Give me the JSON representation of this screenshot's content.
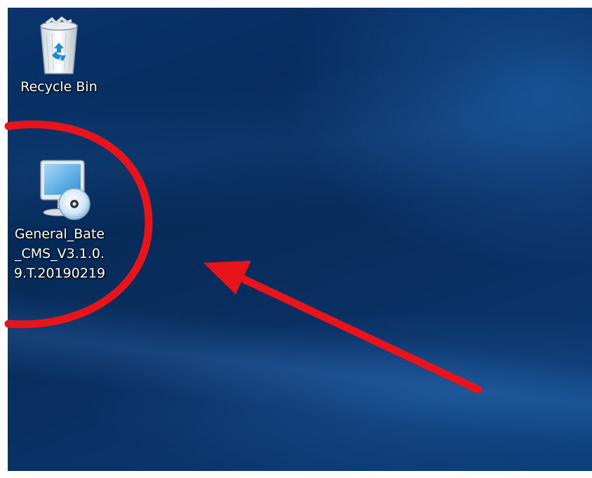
{
  "desktop": {
    "icons": [
      {
        "label": "Recycle Bin",
        "icon": "recycle-bin-icon"
      },
      {
        "label_lines": [
          "General_Bate",
          "_CMS_V3.1.0.",
          "9.T.20190219"
        ],
        "icon": "installer-monitor-disc-icon"
      }
    ]
  },
  "annotation": {
    "color": "#e8141c",
    "shapes": [
      "highlight-circle",
      "pointer-arrow"
    ]
  }
}
